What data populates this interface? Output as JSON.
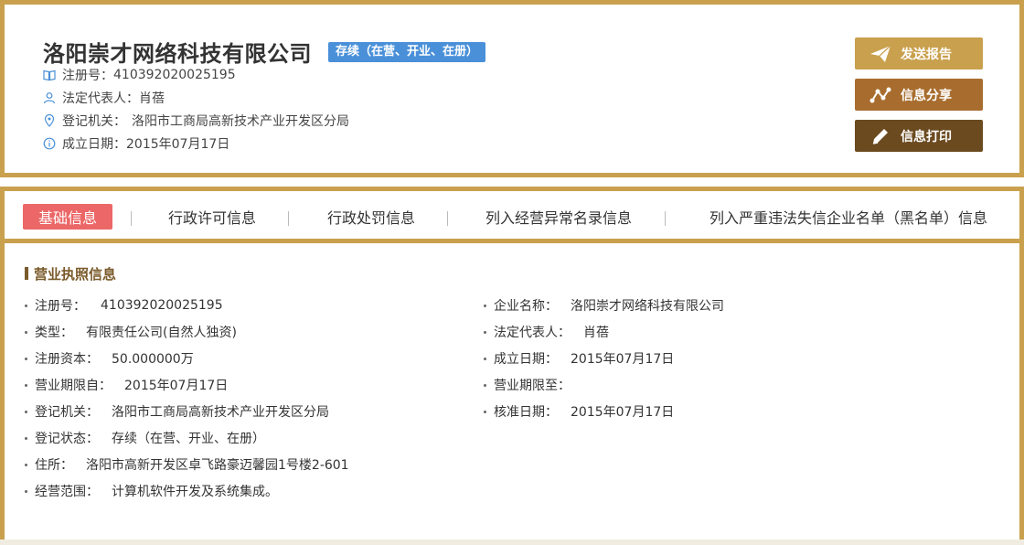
{
  "header": {
    "company_name": "洛阳崇才网络科技有限公司",
    "status_badge": "存续（在营、开业、在册）",
    "reg_no_label": "注册号：",
    "reg_no": "410392020025195",
    "legal_rep_label": "法定代表人：",
    "legal_rep": "肖蓓",
    "authority_label": "登记机关：",
    "authority": "洛阳市工商局高新技术产业开发区分局",
    "found_date_label": "成立日期：",
    "found_date": "2015年07月17日"
  },
  "actions": {
    "report": "发送报告",
    "share": "信息分享",
    "print": "信息打印"
  },
  "tabs": [
    {
      "label": "基础信息",
      "active": true
    },
    {
      "label": "行政许可信息",
      "active": false
    },
    {
      "label": "行政处罚信息",
      "active": false
    },
    {
      "label": "列入经营异常名录信息",
      "active": false
    },
    {
      "label": "列入严重违法失信企业名单（黑名单）信息",
      "active": false
    }
  ],
  "license": {
    "section_title": "营业执照信息",
    "left": [
      {
        "label": "注册号：",
        "value": "410392020025195"
      },
      {
        "label": "类型：",
        "value": "有限责任公司(自然人独资)"
      },
      {
        "label": "注册资本：",
        "value": "50.000000万"
      },
      {
        "label": "营业期限自：",
        "value": "2015年07月17日"
      },
      {
        "label": "登记机关：",
        "value": "洛阳市工商局高新技术产业开发区分局"
      },
      {
        "label": "登记状态：",
        "value": "存续（在营、开业、在册）"
      },
      {
        "label": "住所：",
        "value": "洛阳市高新开发区卓飞路豪迈馨园1号楼2-601"
      },
      {
        "label": "经营范围：",
        "value": "计算机软件开发及系统集成。"
      }
    ],
    "right": [
      {
        "label": "企业名称：",
        "value": "洛阳崇才网络科技有限公司"
      },
      {
        "label": "法定代表人：",
        "value": "肖蓓"
      },
      {
        "label": "成立日期：",
        "value": "2015年07月17日"
      },
      {
        "label": "营业期限至：",
        "value": ""
      },
      {
        "label": "核准日期：",
        "value": "2015年07月17日"
      }
    ]
  },
  "colors": {
    "gold_border": "#c9a04d",
    "badge_blue": "#4a90d9",
    "tab_active": "#ec6767",
    "btn_report": "#c9a04d",
    "btn_share": "#a86d2e",
    "btn_print": "#6b4a1f",
    "icon_blue": "#4a90d9"
  },
  "icons": {
    "reg_no": "book-icon",
    "legal_rep": "person-icon",
    "authority": "location-pin-icon",
    "found_date": "info-icon",
    "report": "paper-plane-icon",
    "share": "share-nodes-icon",
    "print": "pencil-icon"
  }
}
